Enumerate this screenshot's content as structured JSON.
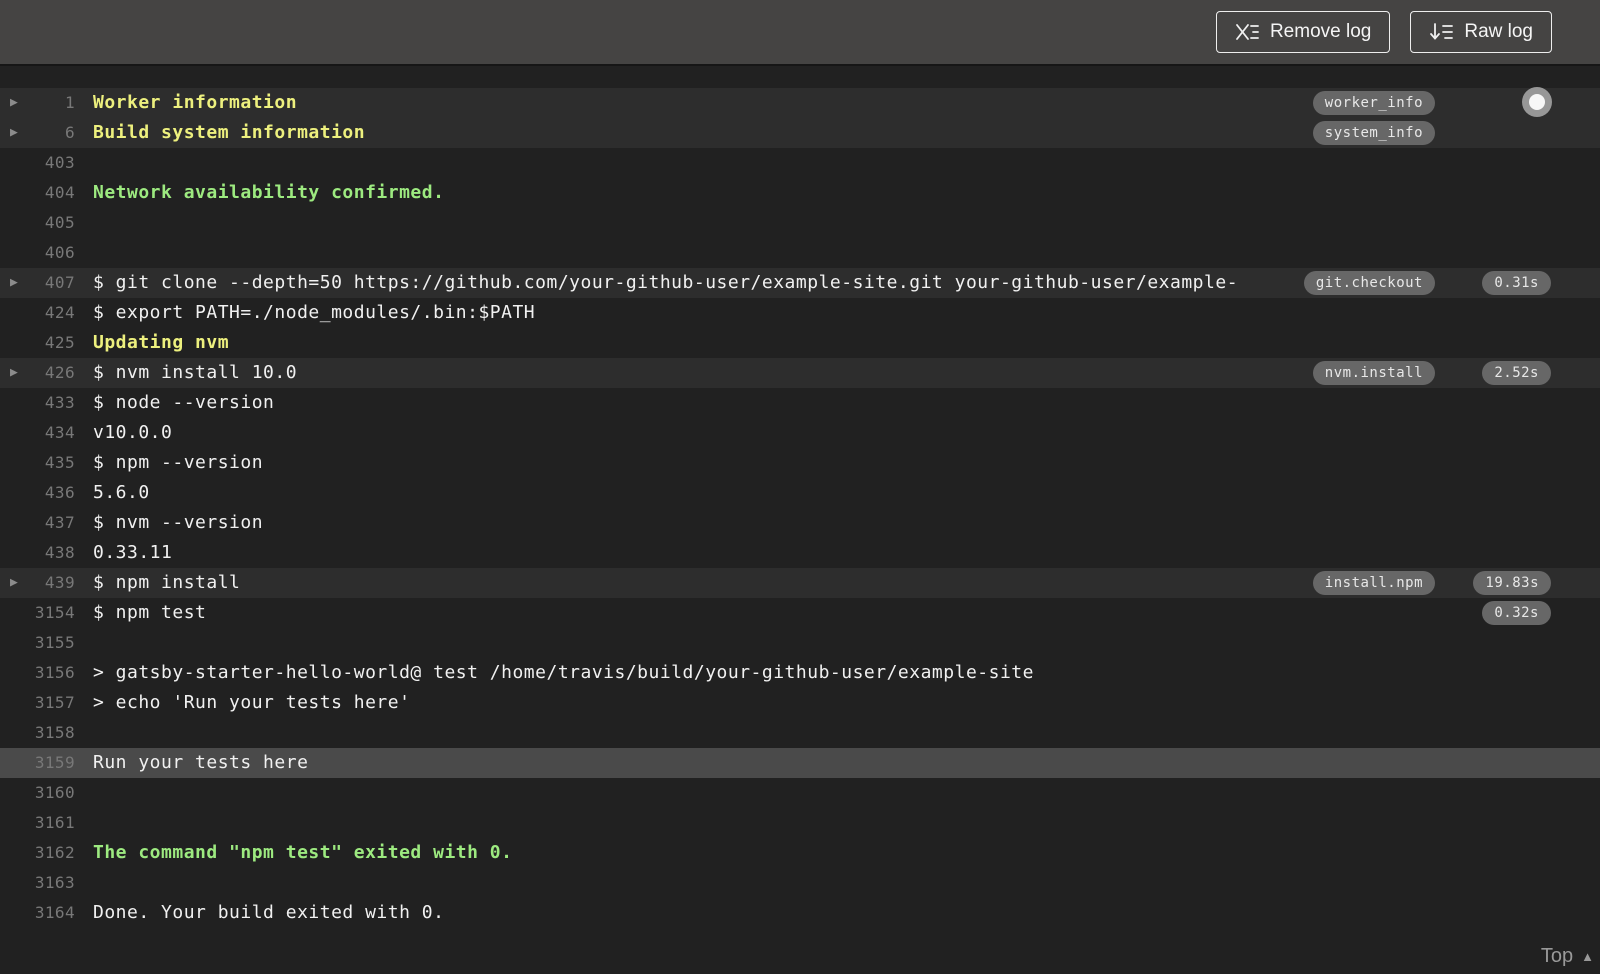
{
  "toolbar": {
    "remove_log_label": "Remove log",
    "raw_log_label": "Raw log"
  },
  "footer": {
    "top_label": "Top"
  },
  "colors": {
    "accent_yellow": "#edf07e",
    "accent_green": "#9dea80",
    "badge_bg": "#676767",
    "highlight_row_bg": "#4a4a4a",
    "header_bg": "#454443",
    "log_bg": "#212121"
  },
  "log": {
    "rows": [
      {
        "n": "1",
        "text": "Worker information",
        "style": "yellow",
        "fold": true,
        "badge": "worker_info"
      },
      {
        "n": "6",
        "text": "Build system information",
        "style": "yellow",
        "fold": true,
        "badge": "system_info"
      },
      {
        "n": "403",
        "text": ""
      },
      {
        "n": "404",
        "text": "Network availability confirmed.",
        "style": "green"
      },
      {
        "n": "405",
        "text": ""
      },
      {
        "n": "406",
        "text": ""
      },
      {
        "n": "407",
        "text": "$ git clone --depth=50 https://github.com/your-github-user/example-site.git your-github-user/example-",
        "fold": true,
        "badge": "git.checkout",
        "duration": "0.31s"
      },
      {
        "n": "424",
        "text": "$ export PATH=./node_modules/.bin:$PATH"
      },
      {
        "n": "425",
        "text": "Updating nvm",
        "style": "yellow"
      },
      {
        "n": "426",
        "text": "$ nvm install 10.0",
        "fold": true,
        "badge": "nvm.install",
        "duration": "2.52s"
      },
      {
        "n": "433",
        "text": "$ node --version"
      },
      {
        "n": "434",
        "text": "v10.0.0"
      },
      {
        "n": "435",
        "text": "$ npm --version"
      },
      {
        "n": "436",
        "text": "5.6.0"
      },
      {
        "n": "437",
        "text": "$ nvm --version"
      },
      {
        "n": "438",
        "text": "0.33.11"
      },
      {
        "n": "439",
        "text": "$ npm install",
        "fold": true,
        "badge": "install.npm",
        "duration": "19.83s"
      },
      {
        "n": "3154",
        "text": "$ npm test",
        "duration": "0.32s"
      },
      {
        "n": "3155",
        "text": ""
      },
      {
        "n": "3156",
        "text": "> gatsby-starter-hello-world@ test /home/travis/build/your-github-user/example-site"
      },
      {
        "n": "3157",
        "text": "> echo 'Run your tests here'"
      },
      {
        "n": "3158",
        "text": ""
      },
      {
        "n": "3159",
        "text": "Run your tests here",
        "highlight": true
      },
      {
        "n": "3160",
        "text": ""
      },
      {
        "n": "3161",
        "text": ""
      },
      {
        "n": "3162",
        "text": "The command \"npm test\" exited with 0.",
        "style": "green"
      },
      {
        "n": "3163",
        "text": ""
      },
      {
        "n": "3164",
        "text": "Done. Your build exited with 0."
      }
    ]
  }
}
